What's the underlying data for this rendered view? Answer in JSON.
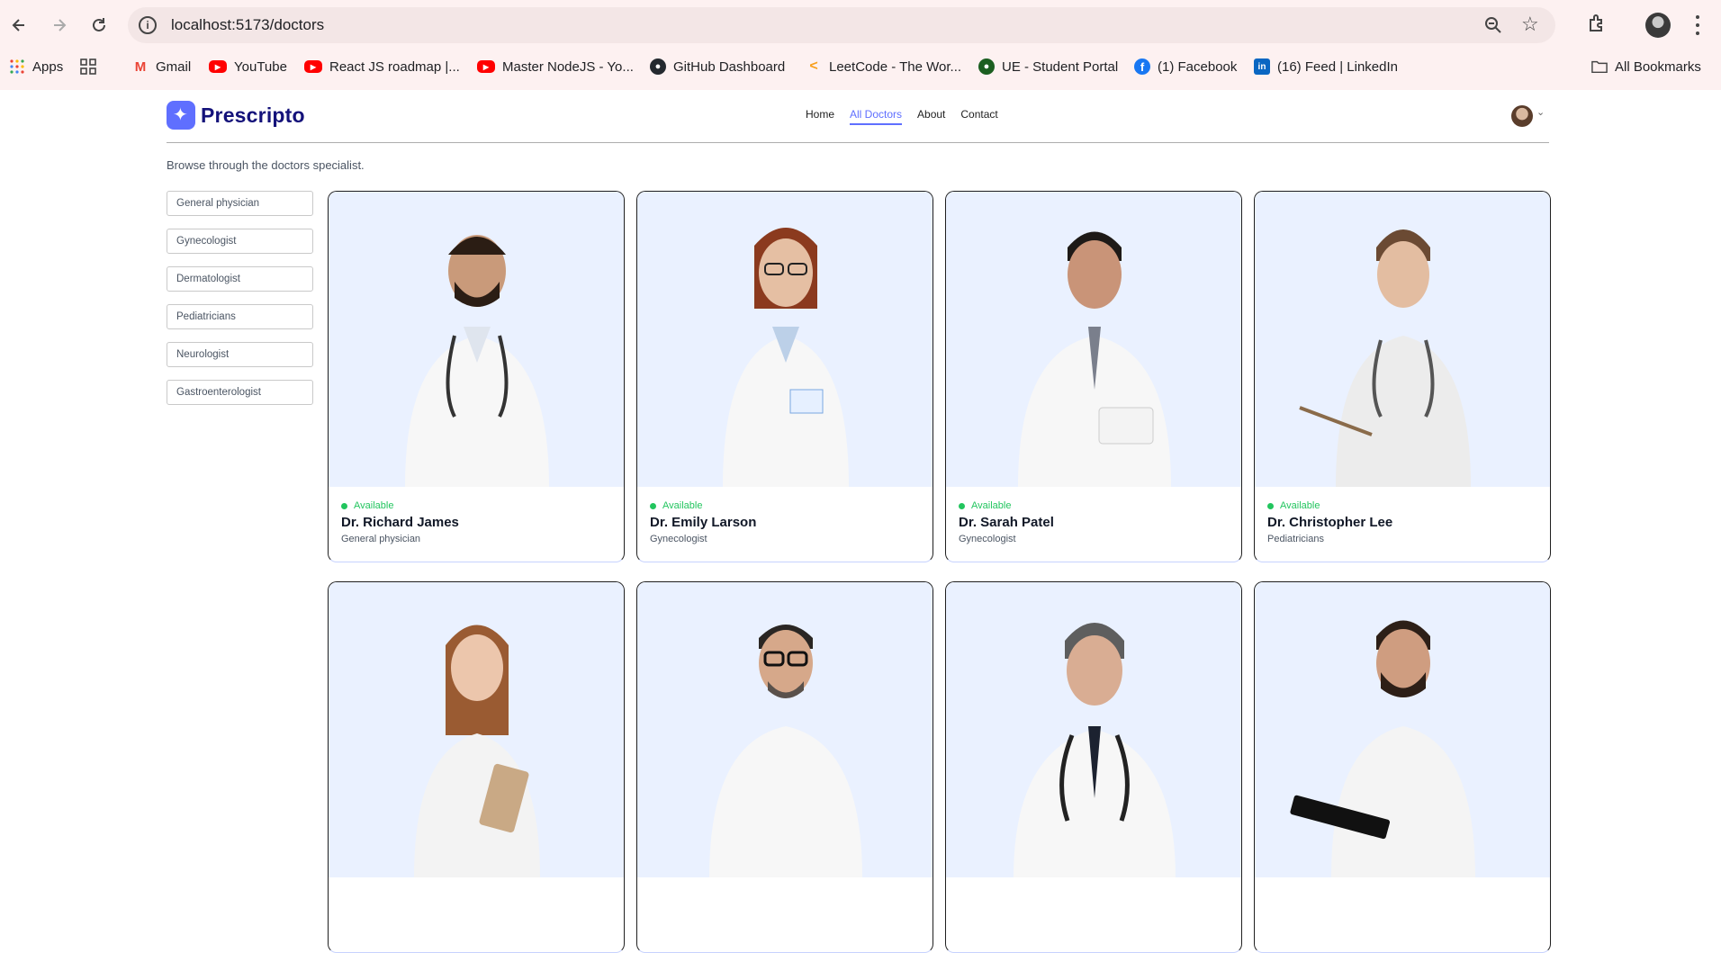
{
  "browser": {
    "url": "localhost:5173/doctors",
    "bookmarks": [
      {
        "label": "Apps",
        "icon": "apps-grid-icon"
      },
      {
        "label": "",
        "icon": "grid-squares-icon"
      },
      {
        "label": "Gmail",
        "icon": "gmail-icon"
      },
      {
        "label": "YouTube",
        "icon": "youtube-icon"
      },
      {
        "label": "React JS roadmap |...",
        "icon": "youtube-icon"
      },
      {
        "label": "Master NodeJS - Yo...",
        "icon": "youtube-icon"
      },
      {
        "label": "GitHub Dashboard",
        "icon": "github-icon"
      },
      {
        "label": "LeetCode - The Wor...",
        "icon": "leetcode-icon"
      },
      {
        "label": "UE - Student Portal",
        "icon": "ue-icon"
      },
      {
        "label": "(1) Facebook",
        "icon": "facebook-icon"
      },
      {
        "label": "(16) Feed | LinkedIn",
        "icon": "linkedin-icon"
      }
    ],
    "all_bookmarks": "All Bookmarks"
  },
  "site": {
    "logo": "Prescripto",
    "nav": [
      "Home",
      "All Doctors",
      "About",
      "Contact"
    ],
    "active_nav": "All Doctors"
  },
  "intro": "Browse through the doctors specialist.",
  "filters": [
    "General physician",
    "Gynecologist",
    "Dermatologist",
    "Pediatricians",
    "Neurologist",
    "Gastroenterologist"
  ],
  "doctors": [
    {
      "status": "Available",
      "name": "Dr. Richard James",
      "speciality": "General physician"
    },
    {
      "status": "Available",
      "name": "Dr. Emily Larson",
      "speciality": "Gynecologist"
    },
    {
      "status": "Available",
      "name": "Dr. Sarah Patel",
      "speciality": "Gynecologist"
    },
    {
      "status": "Available",
      "name": "Dr. Christopher Lee",
      "speciality": "Pediatricians"
    },
    {
      "status": "",
      "name": "",
      "speciality": ""
    },
    {
      "status": "",
      "name": "",
      "speciality": ""
    },
    {
      "status": "",
      "name": "",
      "speciality": ""
    },
    {
      "status": "",
      "name": "",
      "speciality": ""
    }
  ],
  "colors": {
    "accent": "#5f6fff",
    "available": "#22c55e",
    "photo_bg": "#eaf1ff",
    "logo_text": "#14127a"
  }
}
